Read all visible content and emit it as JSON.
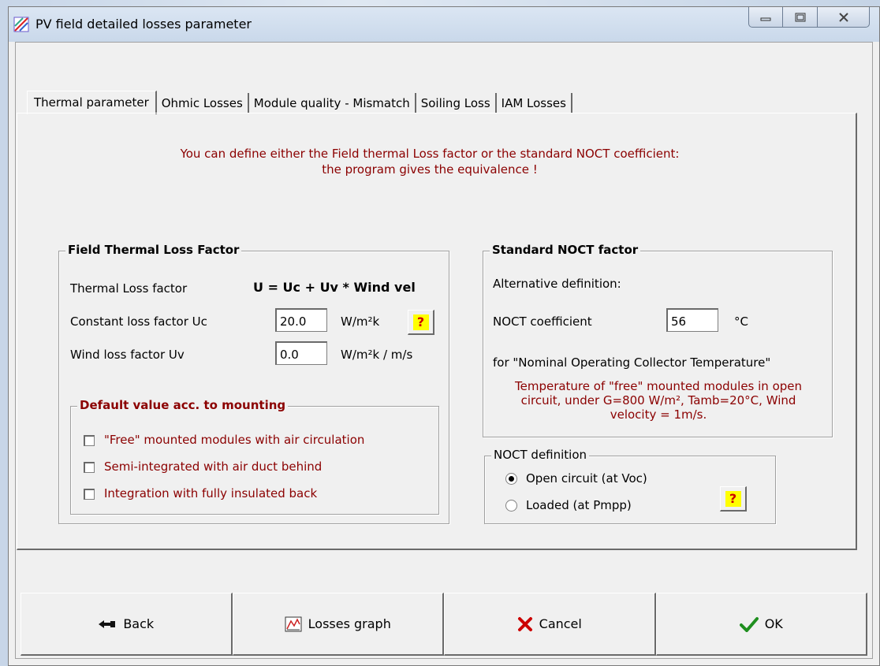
{
  "window": {
    "title": "PV field detailed losses parameter"
  },
  "tabs": [
    {
      "label": "Thermal parameter",
      "active": true
    },
    {
      "label": "Ohmic Losses",
      "active": false
    },
    {
      "label": "Module quality - Mismatch",
      "active": false
    },
    {
      "label": "Soiling Loss",
      "active": false
    },
    {
      "label": "IAM Losses",
      "active": false
    }
  ],
  "info": {
    "line1": "You can define either the Field thermal Loss factor or the standard NOCT coefficient:",
    "line2": "the program gives the equivalence !"
  },
  "thermal": {
    "legend": "Field Thermal Loss Factor",
    "loss_label": "Thermal Loss factor",
    "formula": "U = Uc + Uv * Wind vel",
    "uc_label": "Constant loss factor  Uc",
    "uc_value": "20.0",
    "uc_unit": "W/m²k",
    "uv_label": "Wind loss factor  Uv",
    "uv_value": "0.0",
    "uv_unit": "W/m²k / m/s"
  },
  "mounting": {
    "legend": "Default value acc. to mounting",
    "options": [
      {
        "label": "\"Free\" mounted modules with air circulation",
        "checked": false
      },
      {
        "label": "Semi-integrated with air duct behind",
        "checked": false
      },
      {
        "label": "Integration with fully insulated back",
        "checked": false
      }
    ]
  },
  "noct": {
    "legend": "Standard NOCT factor",
    "alt_def": "Alternative definition:",
    "coef_label": "NOCT coefficient",
    "coef_value": "56",
    "coef_unit": "°C",
    "for_text": "for \"Nominal Operating Collector Temperature\"",
    "desc_line1": "Temperature of \"free\" mounted modules in open",
    "desc_line2": "circuit, under G=800 W/m²,  Tamb=20°C,  Wind",
    "desc_line3": "velocity = 1m/s."
  },
  "noct_def": {
    "legend": "NOCT definition",
    "options": [
      {
        "label": "Open circuit (at Voc)",
        "selected": true
      },
      {
        "label": "Loaded (at Pmpp)",
        "selected": false
      }
    ]
  },
  "buttons": {
    "back": "Back",
    "graph": "Losses graph",
    "cancel": "Cancel",
    "ok": "OK"
  },
  "colors": {
    "info_red": "#8b0000",
    "cancel_x": "#cc0000",
    "ok_check": "#1f8f1f",
    "help_bg": "#ffff00"
  }
}
